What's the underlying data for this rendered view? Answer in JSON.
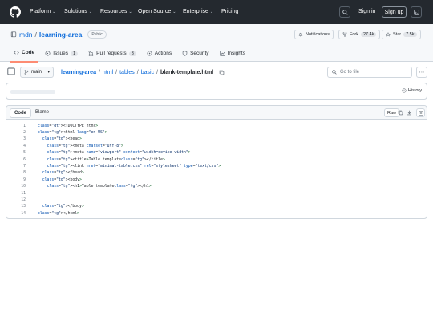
{
  "topnav": {
    "items": [
      {
        "label": "Platform",
        "has_chevron": true
      },
      {
        "label": "Solutions",
        "has_chevron": true
      },
      {
        "label": "Resources",
        "has_chevron": true
      },
      {
        "label": "Open Source",
        "has_chevron": true
      },
      {
        "label": "Enterprise",
        "has_chevron": true
      },
      {
        "label": "Pricing",
        "has_chevron": false
      }
    ],
    "sign_in": "Sign in",
    "sign_up": "Sign up"
  },
  "repo": {
    "owner": "mdn",
    "separator": "/",
    "name": "learning-area",
    "visibility": "Public",
    "notifications_label": "Notifications",
    "fork_label": "Fork",
    "fork_count": "27.4k",
    "star_label": "Star",
    "star_count": "7.5k"
  },
  "tabs": [
    {
      "label": "Code",
      "count": "",
      "active": true,
      "icon": "code-icon"
    },
    {
      "label": "Issues",
      "count": "1",
      "active": false,
      "icon": "issue-icon"
    },
    {
      "label": "Pull requests",
      "count": "3",
      "active": false,
      "icon": "pull-request-icon"
    },
    {
      "label": "Actions",
      "count": "",
      "active": false,
      "icon": "play-icon"
    },
    {
      "label": "Security",
      "count": "",
      "active": false,
      "icon": "shield-icon"
    },
    {
      "label": "Insights",
      "count": "",
      "active": false,
      "icon": "graph-icon"
    }
  ],
  "filenav": {
    "branch": "main",
    "breadcrumb": {
      "repo": "learning-area",
      "parts": [
        "html",
        "tables",
        "basic"
      ],
      "current": "blank-template.html"
    },
    "goto_placeholder": "Go to file"
  },
  "commit": {
    "history_label": "History"
  },
  "file": {
    "view_code": "Code",
    "view_blame": "Blame",
    "raw_label": "Raw",
    "lines": [
      {
        "n": "1",
        "text": "<!DOCTYPE html>"
      },
      {
        "n": "2",
        "text": "<html lang=\"en-US\">"
      },
      {
        "n": "3",
        "text": "  <head>"
      },
      {
        "n": "4",
        "text": "    <meta charset=\"utf-8\">"
      },
      {
        "n": "5",
        "text": "    <meta name=\"viewport\" content=\"width=device-width\">"
      },
      {
        "n": "6",
        "text": "    <title>Table template</title>"
      },
      {
        "n": "7",
        "text": "    <link href=\"minimal-table.css\" rel=\"stylesheet\" type=\"text/css\">"
      },
      {
        "n": "8",
        "text": "  </head>"
      },
      {
        "n": "9",
        "text": "  <body>"
      },
      {
        "n": "10",
        "text": "    <h1>Table template</h1>"
      },
      {
        "n": "11",
        "text": ""
      },
      {
        "n": "12",
        "text": ""
      },
      {
        "n": "13",
        "text": "  </body>"
      },
      {
        "n": "14",
        "text": "</html>"
      }
    ]
  },
  "colors": {
    "nav_bg": "#24292f",
    "link": "#0969da",
    "active_tab_underline": "#fd8c73",
    "tag": "#116329",
    "attr": "#0550ae",
    "string": "#0a3069"
  }
}
